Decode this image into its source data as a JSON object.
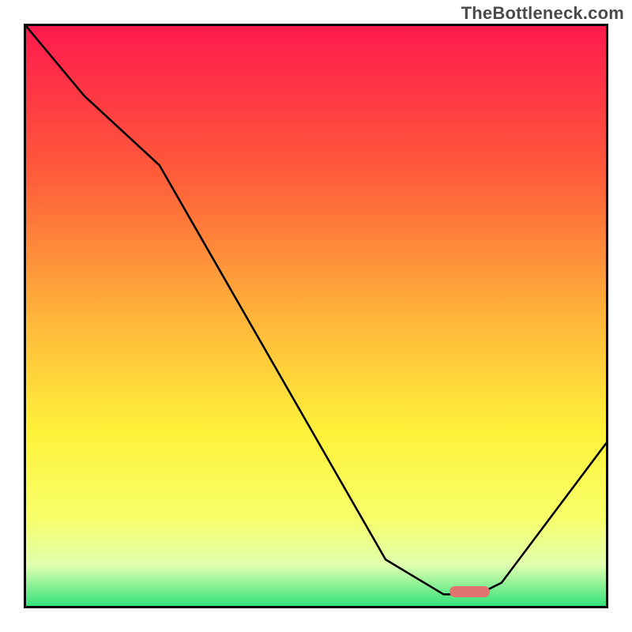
{
  "watermark": "TheBottleneck.com",
  "chart_data": {
    "type": "line",
    "title": "",
    "xlabel": "",
    "ylabel": "",
    "xlim": [
      0,
      100
    ],
    "ylim": [
      0,
      100
    ],
    "grid": false,
    "legend": false,
    "background_gradient": {
      "stops": [
        {
          "pos": 0.0,
          "color": "#ff1a4d"
        },
        {
          "pos": 0.25,
          "color": "#ff5a3a"
        },
        {
          "pos": 0.5,
          "color": "#ffb43a"
        },
        {
          "pos": 0.7,
          "color": "#fff23a"
        },
        {
          "pos": 0.85,
          "color": "#f7ff6a"
        },
        {
          "pos": 0.93,
          "color": "#dfffb0"
        },
        {
          "pos": 1.0,
          "color": "#34e27a"
        }
      ]
    },
    "series": [
      {
        "name": "bottleneck-curve",
        "x": [
          0,
          10,
          23,
          62,
          72,
          78,
          82,
          100
        ],
        "y": [
          100,
          88,
          76,
          8,
          2,
          2,
          4,
          28
        ]
      }
    ],
    "marker": {
      "name": "optimal-range",
      "x_start": 73,
      "x_end": 80,
      "y": 1.5,
      "color": "#e3736f"
    }
  }
}
